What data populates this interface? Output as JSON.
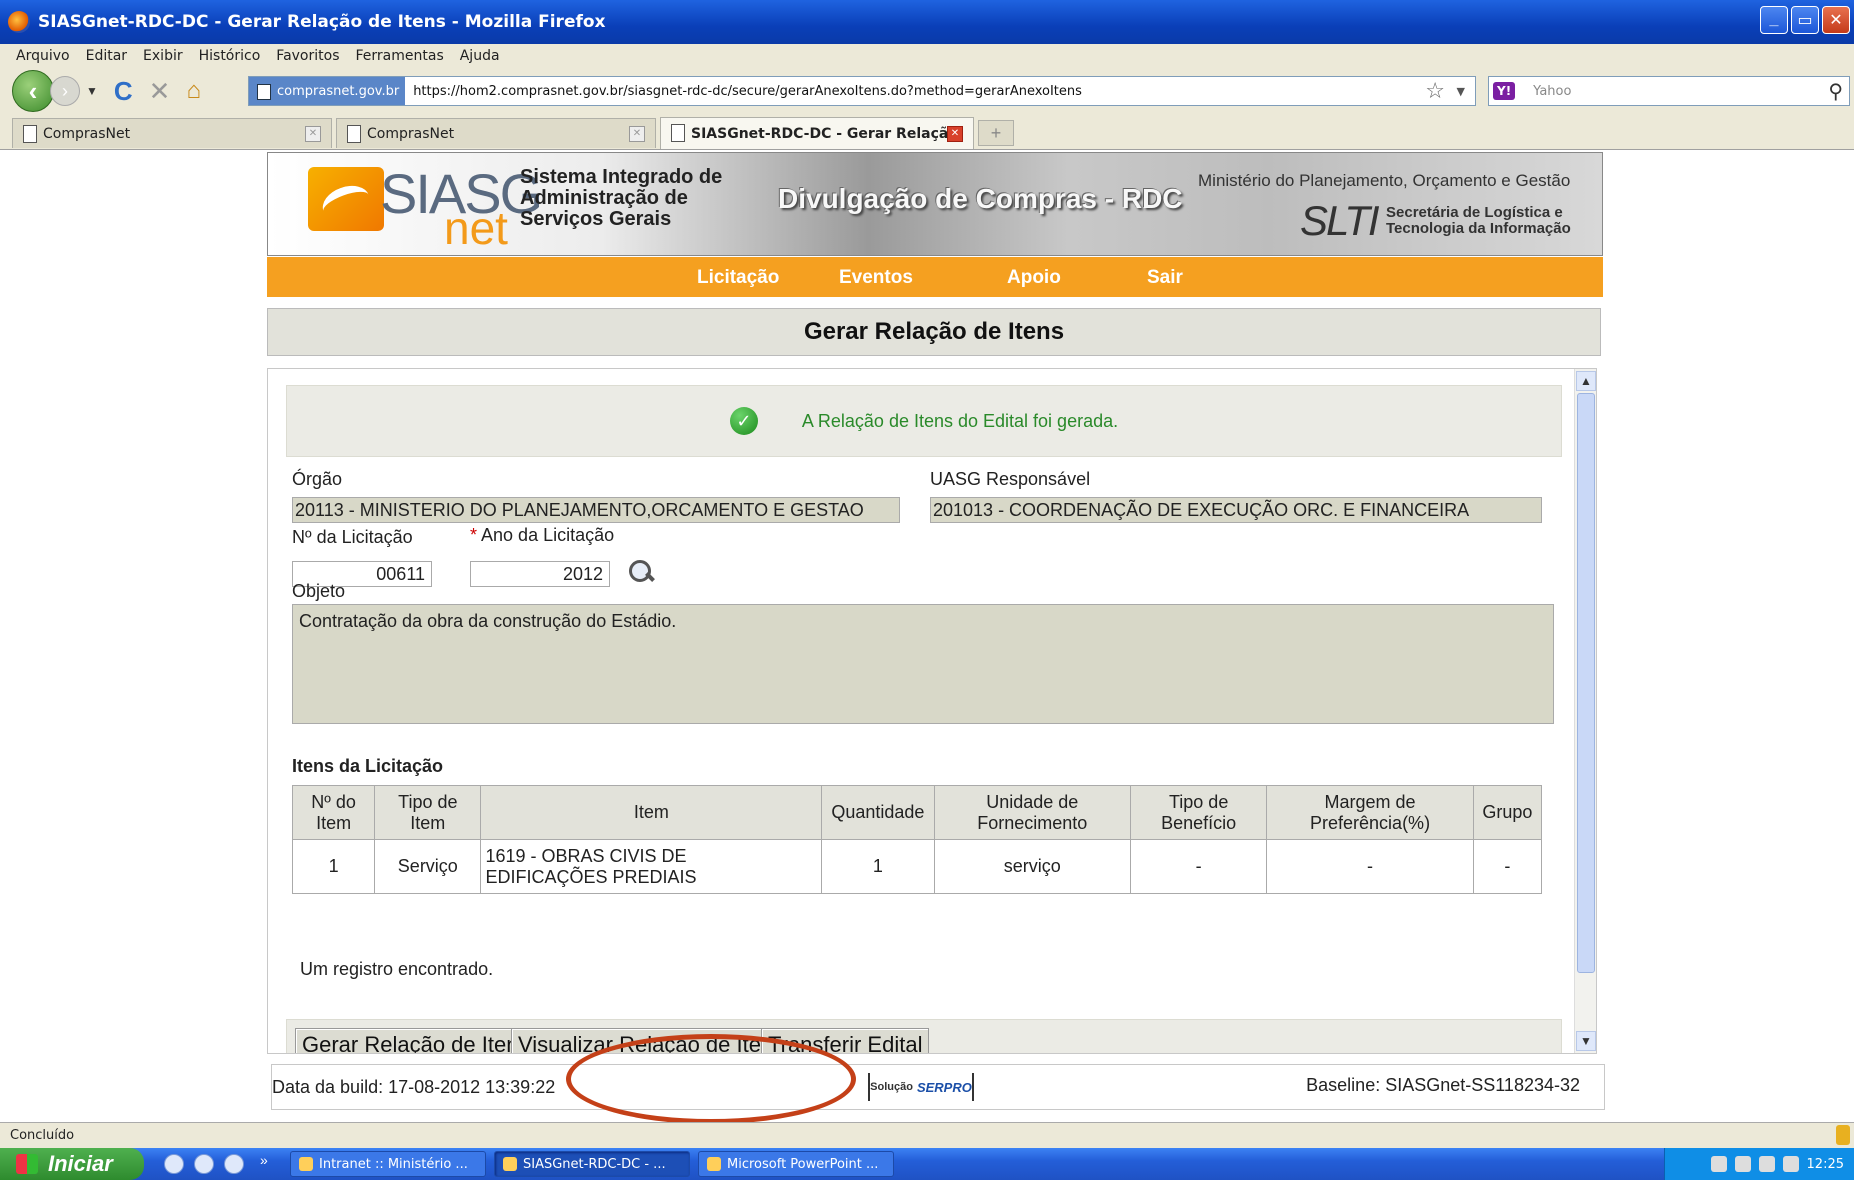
{
  "window": {
    "title": "SIASGnet-RDC-DC - Gerar Relação de Itens - Mozilla Firefox",
    "minimize": "_",
    "maximize": "▭",
    "close": "✕"
  },
  "menu": [
    "Arquivo",
    "Editar",
    "Exibir",
    "Histórico",
    "Favoritos",
    "Ferramentas",
    "Ajuda"
  ],
  "address": {
    "site": "comprasnet.gov.br",
    "url": "https://hom2.comprasnet.gov.br/siasgnet-rdc-dc/secure/gerarAnexoItens.do?method=gerarAnexoItens"
  },
  "search": {
    "engine_badge": "Y!",
    "placeholder": "Yahoo"
  },
  "tabs": [
    {
      "label": "ComprasNet",
      "active": false
    },
    {
      "label": "ComprasNet",
      "active": false
    },
    {
      "label": "SIASGnet-RDC-DC - Gerar Relaçã...",
      "active": true
    }
  ],
  "banner": {
    "logo_siasg": "SIASG",
    "logo_net": "net",
    "sistema_line1": "Sistema Integrado de",
    "sistema_line2": "Administração de",
    "sistema_line3": "Serviços Gerais",
    "divulgacao": "Divulgação de Compras - RDC",
    "ministerio": "Ministério do Planejamento, Orçamento e Gestão",
    "slti": "SLTI",
    "secretaria_line1": "Secretária de Logística e",
    "secretaria_line2": "Tecnologia da Informação"
  },
  "nav": [
    "Licitação",
    "Eventos",
    "Apoio",
    "Sair"
  ],
  "page_title": "Gerar Relação de Itens",
  "success_message": "A Relação de Itens do Edital foi gerada.",
  "form": {
    "orgao_label": "Órgão",
    "orgao_value": "20113 - MINISTERIO DO PLANEJAMENTO,ORCAMENTO E GESTAO",
    "uasg_label": "UASG Responsável",
    "uasg_value": "201013 - COORDENAÇÃO DE EXECUÇÃO ORC. E FINANCEIRA",
    "numero_label": "Nº da Licitação",
    "numero_value": "00611",
    "ano_required": "*",
    "ano_label": "Ano da Licitação",
    "ano_value": "2012",
    "objeto_label": "Objeto",
    "objeto_value": "Contratação da obra da construção do Estádio."
  },
  "itens": {
    "title": "Itens da Licitação",
    "headers": [
      [
        "Nº do",
        "Item"
      ],
      [
        "Tipo de",
        "Item"
      ],
      [
        "Item",
        ""
      ],
      [
        "Quantidade",
        ""
      ],
      [
        "Unidade de",
        "Fornecimento"
      ],
      [
        "Tipo de",
        "Benefício"
      ],
      [
        "Margem de",
        "Preferência(%)"
      ],
      [
        "Grupo",
        ""
      ]
    ],
    "rows": [
      {
        "numero": "1",
        "tipo": "Serviço",
        "item_line1": "1619 - OBRAS CIVIS DE",
        "item_line2": "EDIFICAÇÕES PREDIAIS",
        "quantidade": "1",
        "unidade": "serviço",
        "beneficio": "-",
        "margem": "-",
        "grupo": "-"
      }
    ],
    "count_text": "Um registro encontrado."
  },
  "buttons": {
    "gerar": "Gerar Relação de Itens",
    "visualizar": "Visualizar Relação de Itens",
    "transferir": "Transferir Edital"
  },
  "footer": {
    "build": "Data da build: 17-08-2012 13:39:22",
    "serpro_prefix": "Solução",
    "serpro_name": "SERPRO",
    "baseline": "Baseline: SIASGnet-SS118234-32"
  },
  "status": "Concluído",
  "taskbar": {
    "start": "Iniciar",
    "more": "»",
    "tasks": [
      "Intranet :: Ministério ...",
      "SIASGnet-RDC-DC - ...",
      "Microsoft PowerPoint ..."
    ],
    "clock": "12:25"
  },
  "colors": {
    "accent_orange": "#f5a020",
    "success_green": "#2a8a2a",
    "annotation_red": "#c44018"
  }
}
